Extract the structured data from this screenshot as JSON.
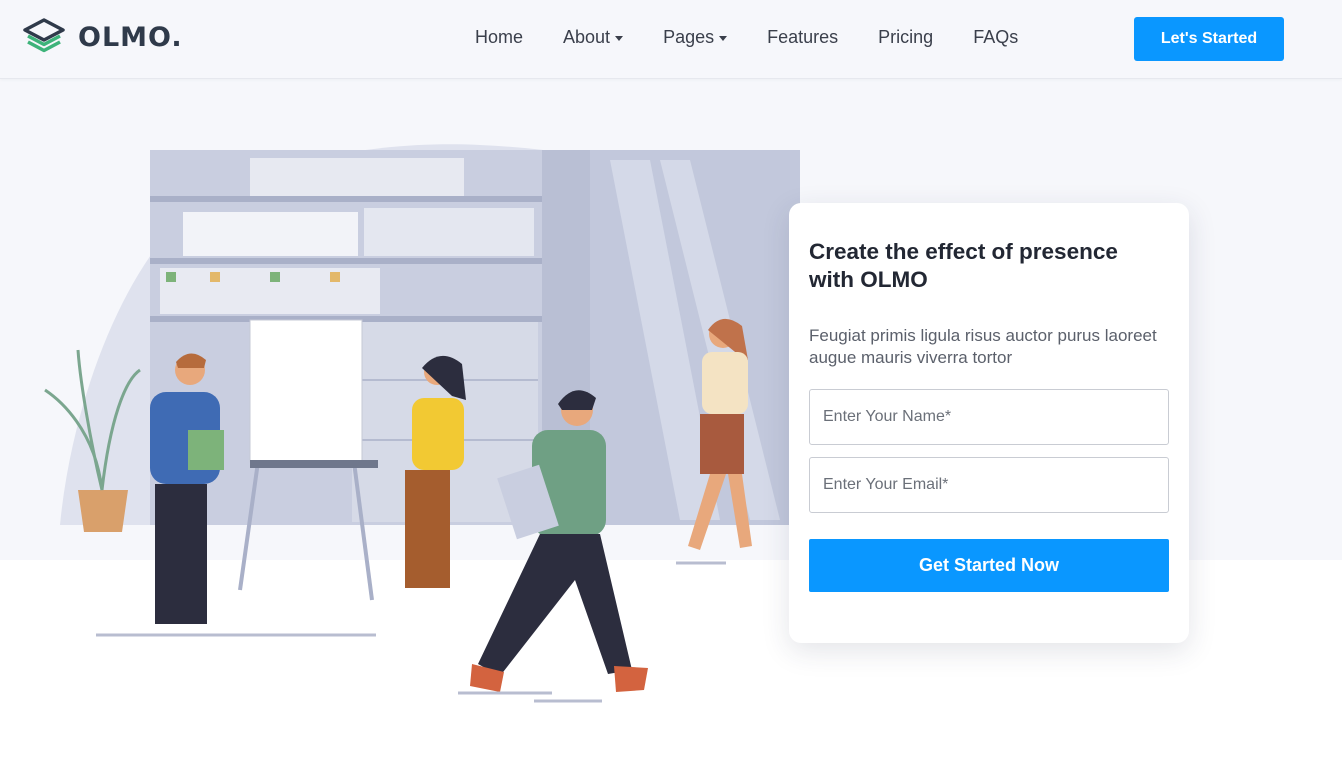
{
  "brand": {
    "name": "OLMO.",
    "icon": "layers-logo-icon"
  },
  "nav": {
    "items": [
      {
        "label": "Home",
        "dropdown": false
      },
      {
        "label": "About",
        "dropdown": true
      },
      {
        "label": "Pages",
        "dropdown": true
      },
      {
        "label": "Features",
        "dropdown": false
      },
      {
        "label": "Pricing",
        "dropdown": false
      },
      {
        "label": "FAQs",
        "dropdown": false
      }
    ],
    "cta_label": "Let's Started"
  },
  "hero": {
    "title": "Create the effect of presence with OLMO",
    "text": "Feugiat primis ligula risus auctor purus laoreet augue mauris viverra tortor",
    "name_placeholder": "Enter Your Name*",
    "email_placeholder": "Enter Your Email*",
    "submit_label": "Get Started Now"
  },
  "colors": {
    "accent": "#0a97ff",
    "dark": "#2f3a4a",
    "logo_green": "#3db37a"
  }
}
